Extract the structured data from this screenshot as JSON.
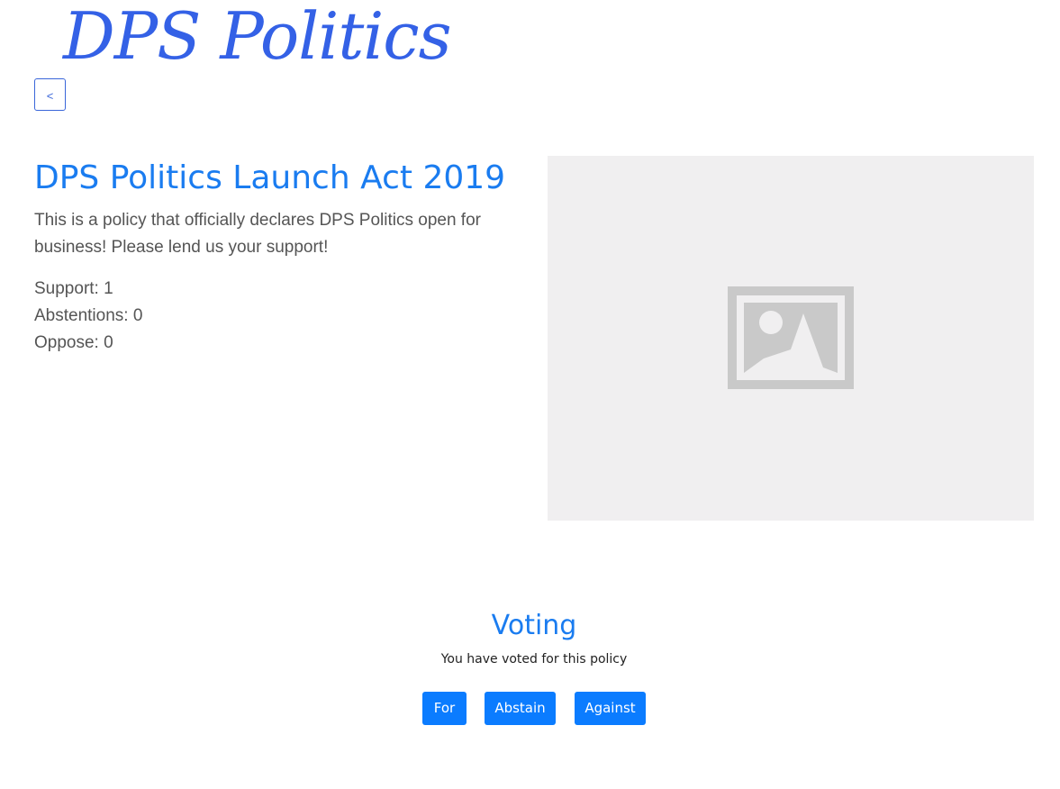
{
  "header": {
    "logo_text": "DPS Politics",
    "back_label": "<"
  },
  "policy": {
    "title": "DPS Politics Launch Act 2019",
    "description": "This is a policy that officially declares DPS Politics open for business! Please lend us your support!",
    "support": "Support: 1",
    "abstentions": "Abstentions: 0",
    "oppose": "Oppose: 0",
    "image_icon": "image-placeholder-icon"
  },
  "voting": {
    "title": "Voting",
    "status_message": "You have voted for this policy",
    "for_label": "For",
    "abstain_label": "Abstain",
    "against_label": "Against"
  },
  "colors": {
    "brand": "#3461e6",
    "primary": "#0b7cff",
    "heading": "#1a7cf0",
    "placeholder_bg": "#f0eff0",
    "placeholder_icon": "#c9c9c9"
  }
}
